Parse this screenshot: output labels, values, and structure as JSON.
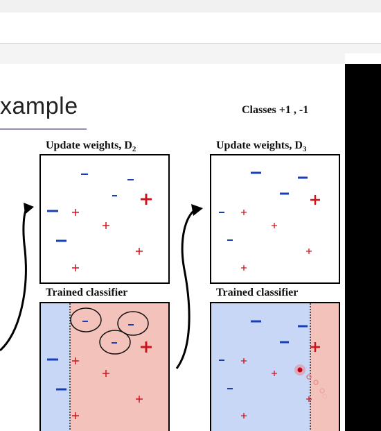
{
  "title": "xample",
  "classes_label": "Classes  +1 , -1",
  "panels": {
    "left_top_title": "Update weights,  D",
    "left_top_sub": "2",
    "right_top_title": "Update weights,  D",
    "right_top_sub": "3",
    "left_bottom_title": "Trained classifier",
    "right_bottom_title": "Trained classifier"
  },
  "colors": {
    "positive": "#d0141e",
    "negative": "#1a3fb5",
    "region_negative": "#c7d7f5",
    "region_positive": "#f3c2bb"
  }
}
